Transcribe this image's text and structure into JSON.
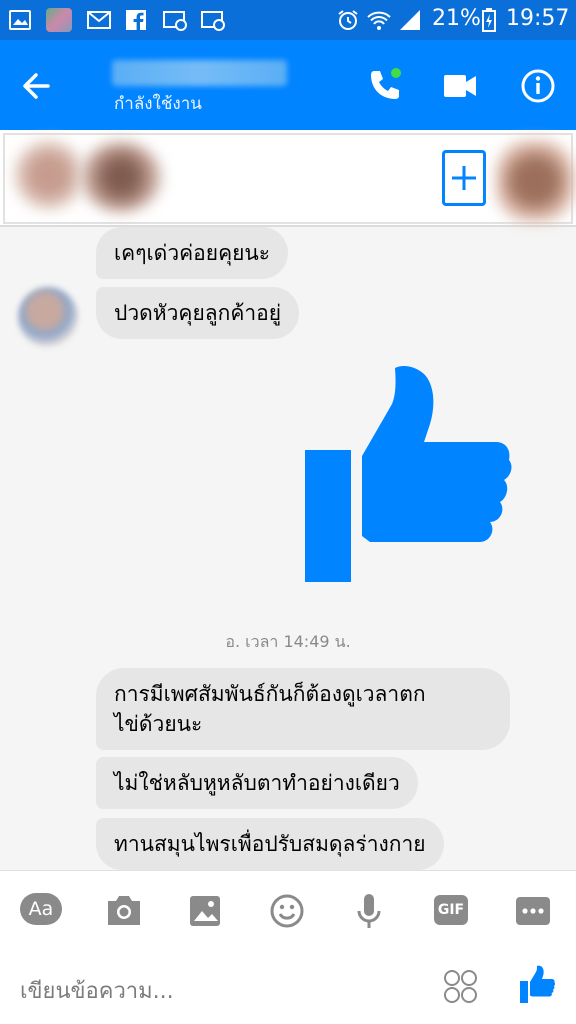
{
  "status_bar": {
    "battery_percent": "21%",
    "time": "19:57",
    "icons": [
      "gallery-icon",
      "app-icon",
      "email-icon",
      "facebook-icon",
      "cast-icon",
      "cast-icon",
      "alarm-icon",
      "wifi-icon",
      "signal-icon",
      "battery-icon"
    ]
  },
  "header": {
    "status": "กำลังใช้งาน",
    "icons": [
      "back-arrow-icon",
      "phone-icon",
      "video-icon",
      "info-icon"
    ],
    "colors": {
      "bar": "#0084ff",
      "online_dot": "#44dd44"
    }
  },
  "messages": [
    {
      "id": "m1",
      "sender": "them",
      "text": "เคๆเด่วค่อยคุยนะ"
    },
    {
      "id": "m2",
      "sender": "them",
      "text": "ปวดหัวคุยลูกค้าอยู่"
    },
    {
      "id": "m3",
      "sender": "me",
      "type": "like-sticker"
    },
    {
      "id": "m4",
      "sender": "them",
      "text": "การมีเพศสัมพันธ์กันก็ต้องดูเวลาตก\nไข่ด้วยนะ"
    },
    {
      "id": "m5",
      "sender": "them",
      "text": "ไม่ใช่หลับหูหลับตาทำอย่างเดียว"
    },
    {
      "id": "m6",
      "sender": "them",
      "text": "ทานสมุนไพรเพื่อปรับสมดุลร่างกาย"
    }
  ],
  "timestamp": "อ. เวลา 14:49 น.",
  "composer": {
    "placeholder": "เขียนข้อความ...",
    "tools": [
      "Aa",
      "camera-icon",
      "image-icon",
      "emoji-icon",
      "mic-icon",
      "GIF",
      "more-icon"
    ],
    "aa_label": "Aa",
    "gif_label": "GIF"
  },
  "colors": {
    "accent": "#0084ff",
    "bubble": "#e6e6e6",
    "icon_gray": "#8a8a8a"
  }
}
